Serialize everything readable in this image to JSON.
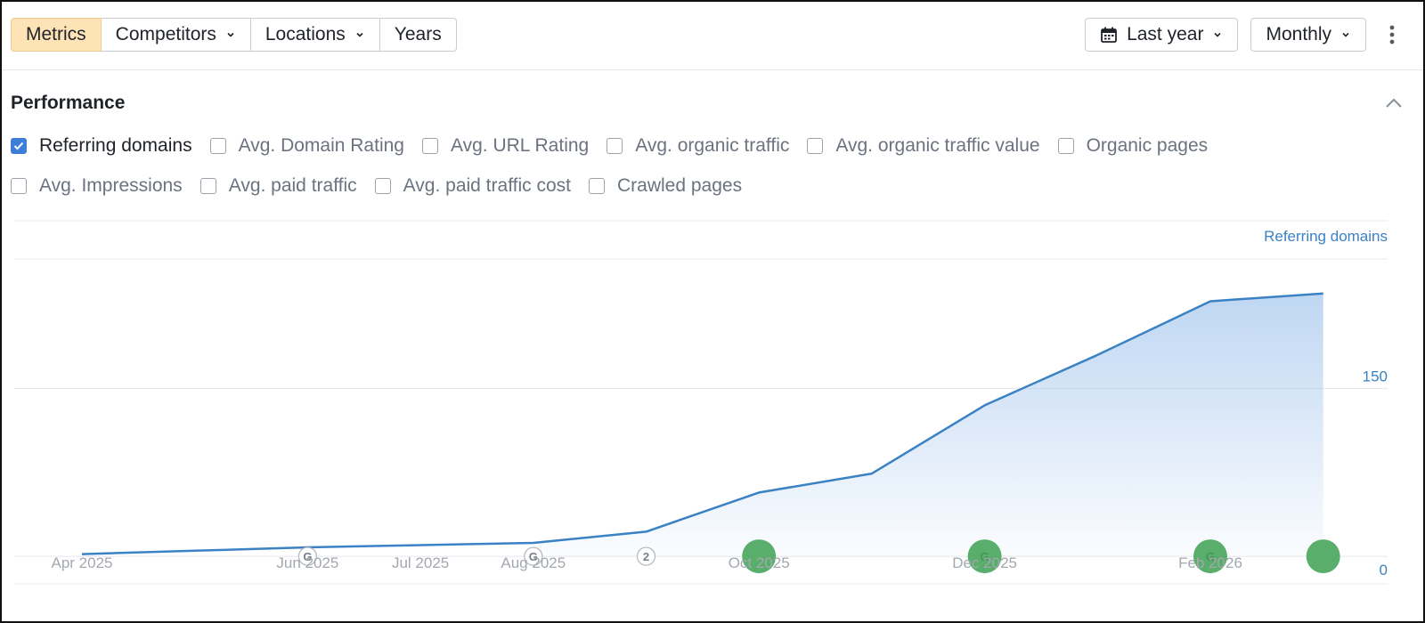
{
  "toolbar": {
    "segments": [
      {
        "label": "Metrics",
        "active": true,
        "dropdown": false
      },
      {
        "label": "Competitors",
        "active": false,
        "dropdown": true
      },
      {
        "label": "Locations",
        "active": false,
        "dropdown": true
      },
      {
        "label": "Years",
        "active": false,
        "dropdown": false
      }
    ],
    "date_range": {
      "label": "Last year",
      "icon": "calendar-icon"
    },
    "interval": {
      "label": "Monthly"
    },
    "more_icon": "kebab-icon"
  },
  "performance": {
    "title": "Performance",
    "collapse_icon": "chevron-up-icon"
  },
  "metrics_row1": [
    {
      "label": "Referring domains",
      "checked": true
    },
    {
      "label": "Avg. Domain Rating",
      "checked": false
    },
    {
      "label": "Avg. URL Rating",
      "checked": false
    },
    {
      "label": "Avg. organic traffic",
      "checked": false
    },
    {
      "label": "Avg. organic traffic value",
      "checked": false
    },
    {
      "label": "Organic pages",
      "checked": false
    }
  ],
  "metrics_row2": [
    {
      "label": "Avg. Impressions",
      "checked": false
    },
    {
      "label": "Avg. paid traffic",
      "checked": false
    },
    {
      "label": "Avg. paid traffic cost",
      "checked": false
    },
    {
      "label": "Crawled pages",
      "checked": false
    }
  ],
  "colors": {
    "line": "#3b82c4",
    "area_top": "#a9c9ee",
    "axis_label": "#3b82c4",
    "grid": "#e6e8eb",
    "marker_green": "#5aae6c",
    "active_segment": "#fde3b6",
    "checkbox": "#3d7fd8"
  },
  "chart_data": {
    "type": "area",
    "series": [
      {
        "name": "Referring domains",
        "x": [
          "2025-04-01",
          "2025-05-01",
          "2025-06-01",
          "2025-07-01",
          "2025-08-01",
          "2025-09-01",
          "2025-10-01",
          "2025-11-01",
          "2025-12-01",
          "2026-01-01",
          "2026-02-01",
          "2026-03-01"
        ],
        "values": [
          2,
          5,
          8,
          10,
          12,
          22,
          57,
          74,
          135,
          180,
          228,
          235
        ]
      }
    ],
    "x_tick_labels": [
      "Apr 2025",
      "Jun 2025",
      "Jul 2025",
      "Aug 2025",
      "Oct 2025",
      "Dec 2025",
      "Feb 2026"
    ],
    "x_tick_dates": [
      "2025-04-01",
      "2025-06-01",
      "2025-07-01",
      "2025-08-01",
      "2025-10-01",
      "2025-12-01",
      "2026-02-01"
    ],
    "y_axis": {
      "label": "Referring domains",
      "position": "right",
      "ticks": [
        0,
        150,
        300,
        450,
        600
      ],
      "ylim": [
        -23,
        265
      ]
    },
    "grid": true,
    "annotations": [
      {
        "x": "2025-06-01",
        "kind": "google-update",
        "text": "G"
      },
      {
        "x": "2025-08-01",
        "kind": "google-update",
        "text": "G"
      },
      {
        "x": "2025-09-01",
        "kind": "count",
        "text": "2"
      },
      {
        "x": "2025-10-01",
        "kind": "green-marker",
        "text": ""
      },
      {
        "x": "2025-12-01",
        "kind": "green-marker",
        "text": "G"
      },
      {
        "x": "2026-02-01",
        "kind": "green-marker",
        "text": "G"
      },
      {
        "x": "2026-03-01",
        "kind": "green-marker",
        "text": ""
      }
    ]
  }
}
